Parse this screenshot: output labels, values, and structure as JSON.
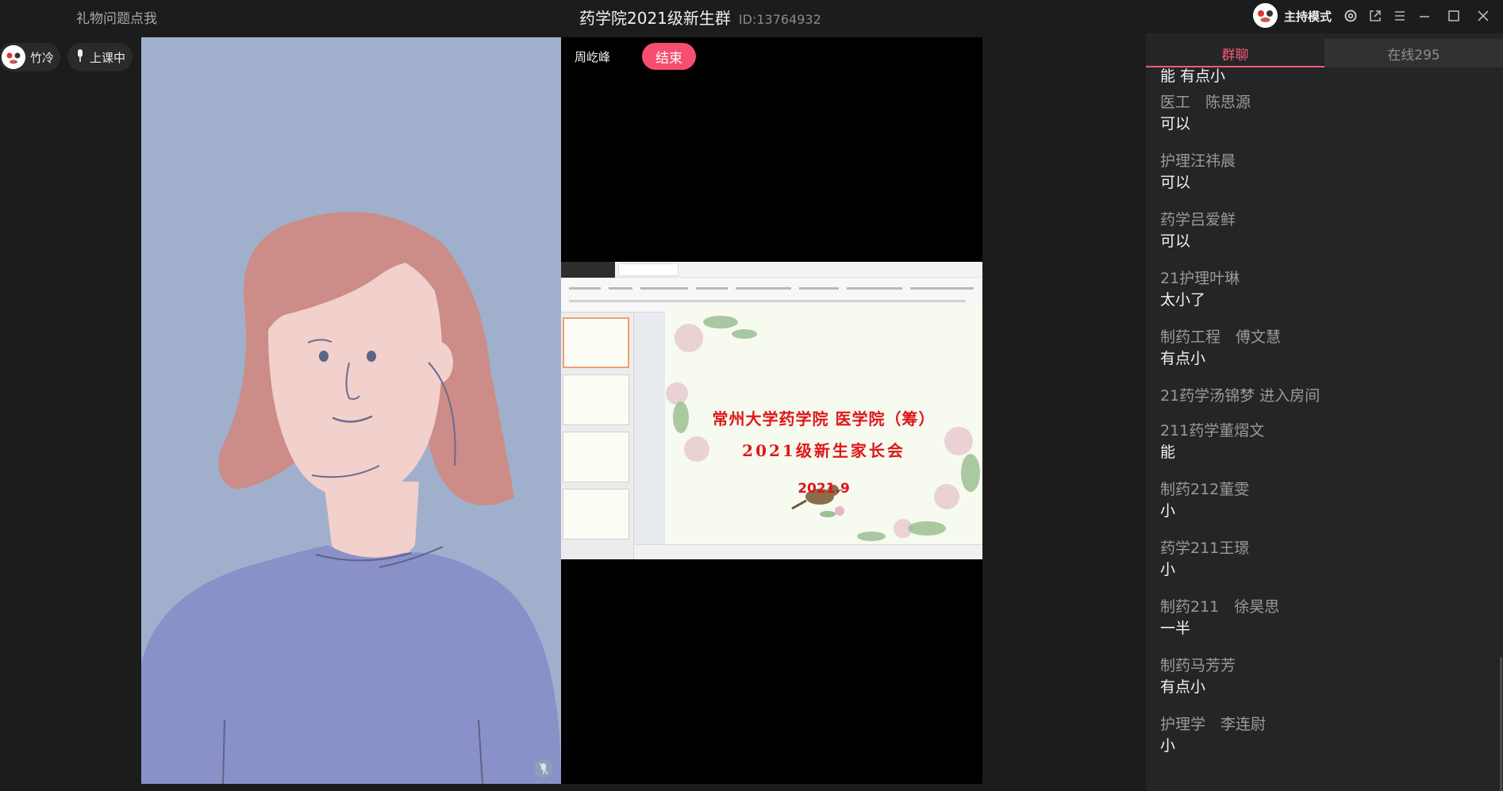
{
  "titlebar": {
    "gift_link": "礼物问题点我",
    "title": "药学院2021级新生群",
    "room_id": "ID:13764932",
    "host_mode": "主持模式"
  },
  "left_bar": {
    "user_name": "竹冷",
    "class_status": "上课中"
  },
  "stage": {
    "presenter_name": "周屹峰",
    "end_button": "结束"
  },
  "shared_slide": {
    "title_line1": "常州大学药学院 医学院（筹）",
    "title_line2": "2021级新生家长会",
    "date": "2021.9"
  },
  "chat": {
    "tabs": [
      {
        "label": "群聊",
        "active": true
      },
      {
        "label": "在线295",
        "active": false
      }
    ],
    "partial_top_text": "能 有点小",
    "messages": [
      {
        "sender": "医工　陈思源",
        "text": "可以"
      },
      {
        "sender": "护理汪祎晨",
        "text": "可以"
      },
      {
        "sender": "药学吕爱鲜",
        "text": "可以"
      },
      {
        "sender": "21护理叶琳",
        "text": "太小了"
      },
      {
        "sender": "制药工程　傅文慧",
        "text": "有点小"
      },
      {
        "sender": "21药学汤锦梦 进入房间",
        "text": ""
      },
      {
        "sender": "211药学董熠文",
        "text": "能"
      },
      {
        "sender": "制药212董雯",
        "text": "小"
      },
      {
        "sender": "药学211王璟",
        "text": "小"
      },
      {
        "sender": "制药211　徐昊思",
        "text": "一半"
      },
      {
        "sender": "制药马芳芳",
        "text": "有点小"
      },
      {
        "sender": "护理学　李连尉",
        "text": "小"
      }
    ]
  },
  "colors": {
    "accent": "#f55a78",
    "end_button": "#f64e6e",
    "background": "#1c1c1c",
    "chat_background": "#252525",
    "slide_title": "#e0161a"
  },
  "icons": [
    "mic-icon",
    "settings-icon",
    "popout-icon",
    "menu-icon",
    "minimize-icon",
    "maximize-icon",
    "close-icon",
    "mic-muted-icon"
  ]
}
